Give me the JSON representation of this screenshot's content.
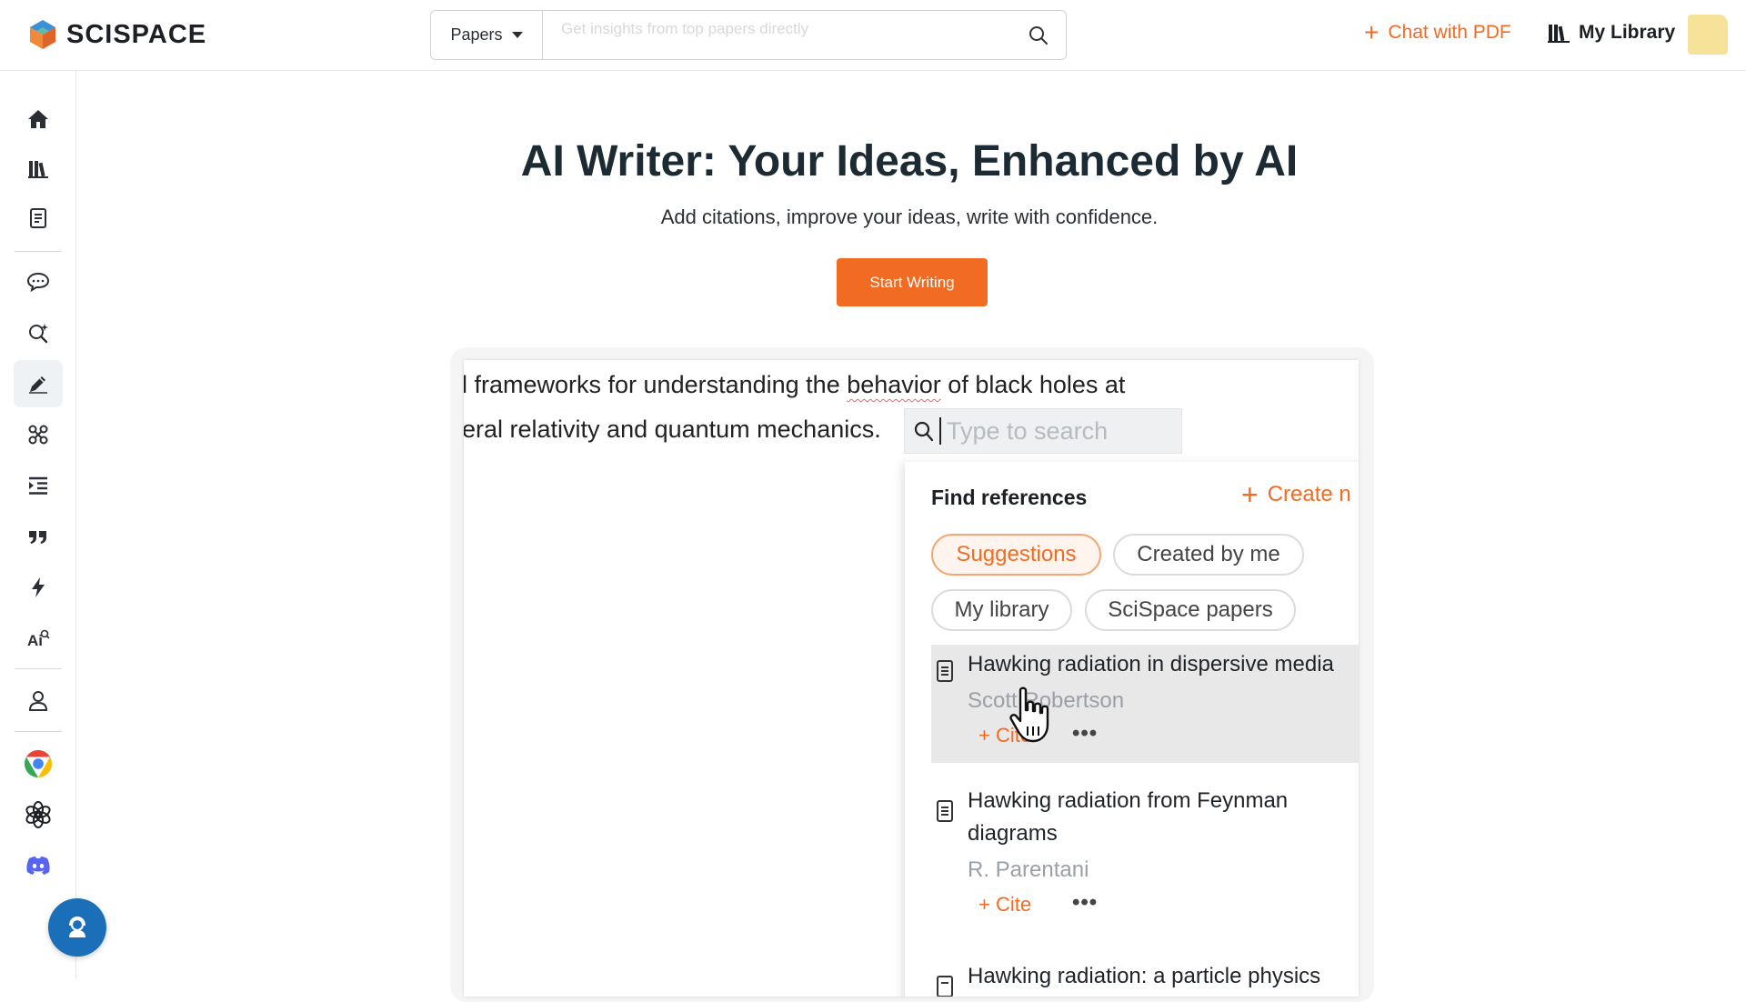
{
  "header": {
    "logo_text": "SCISPACE",
    "search": {
      "type_label": "Papers",
      "placeholder": "Get insights from top papers directly"
    },
    "chat_pdf_label": "Chat with PDF",
    "my_library_label": "My Library"
  },
  "sidebar": {
    "items": [
      {
        "icon": "home-icon"
      },
      {
        "icon": "library-icon"
      },
      {
        "icon": "notebook-icon"
      },
      {
        "icon": "chat-icon"
      },
      {
        "icon": "search-sparkle-icon"
      },
      {
        "icon": "pen-icon",
        "active": true
      },
      {
        "icon": "molecule-icon"
      },
      {
        "icon": "indent-icon"
      },
      {
        "icon": "quote-icon"
      },
      {
        "icon": "lightning-icon"
      },
      {
        "icon": "ai-detect-icon"
      },
      {
        "icon": "user-icon"
      },
      {
        "icon": "chrome-icon"
      },
      {
        "icon": "openai-icon"
      },
      {
        "icon": "discord-icon"
      }
    ]
  },
  "hero": {
    "title": "AI Writer: Your Ideas, Enhanced by AI",
    "subtitle": "Add citations, improve your ideas, write with confidence.",
    "cta_label": "Start Writing"
  },
  "demo": {
    "line1_pre": "l frameworks for understanding the ",
    "line1_word": "behavior",
    "line1_post": " of black holes at",
    "line2": "eral relativity and quantum mechanics.",
    "search_placeholder": "Type to search",
    "panel": {
      "title": "Find references",
      "create_label": "Create n",
      "chips": [
        "Suggestions",
        "Created by me",
        "My library",
        "SciSpace papers"
      ],
      "results": [
        {
          "title": "Hawking radiation in dispersive media",
          "author": "Scott Robertson",
          "cite": "+ Cite",
          "more": "•••"
        },
        {
          "title": "Hawking radiation from Feynman diagrams",
          "author": "R. Parentani",
          "cite": "+ Cite",
          "more": "•••"
        },
        {
          "title": "Hawking radiation: a particle physics"
        }
      ]
    }
  },
  "colors": {
    "accent": "#f26b22",
    "support": "#1b6fb8"
  }
}
